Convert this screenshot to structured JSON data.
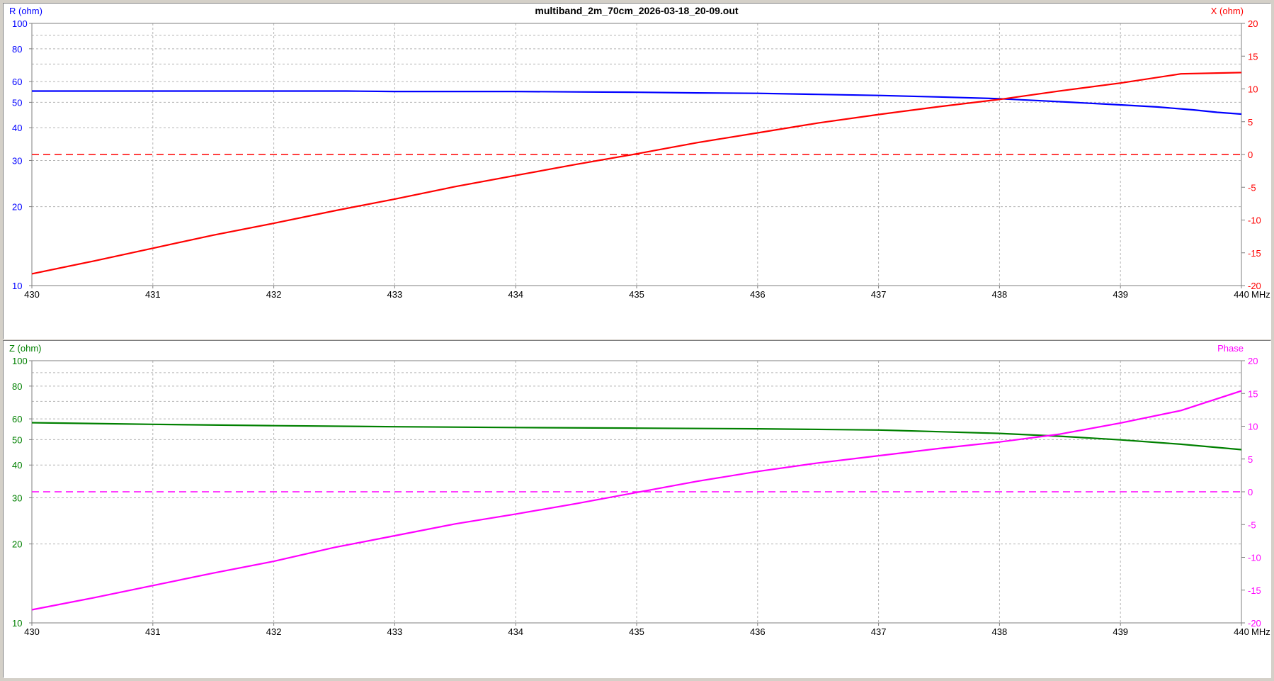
{
  "window": {
    "title": "multiband_2m_70cm_2026-03-18_20-09.out"
  },
  "colors": {
    "r": "#0000ff",
    "x": "#ff0000",
    "z": "#008000",
    "phase": "#ff00ff",
    "grid": "#b4b4b4",
    "frame": "#7f7f7f"
  },
  "chart_data": [
    {
      "type": "line",
      "title": "multiband_2m_70cm_2026-03-18_20-09.out",
      "xlabel": "MHz",
      "xlim": [
        430,
        440
      ],
      "x_ticks": [
        "430",
        "431",
        "432",
        "433",
        "434",
        "435",
        "436",
        "437",
        "438",
        "439",
        "440"
      ],
      "left_axis": {
        "label": "R (ohm)",
        "scale": "log",
        "lim": [
          10,
          100
        ],
        "ticks": [
          "10",
          "20",
          "30",
          "40",
          "50",
          "60",
          "80",
          "100"
        ]
      },
      "right_axis": {
        "label": "X (ohm)",
        "scale": "linear",
        "lim": [
          -20,
          20
        ],
        "ticks": [
          "-20",
          "-15",
          "-10",
          "-5",
          "0",
          "5",
          "10",
          "15",
          "20"
        ]
      },
      "grid": true,
      "reference_line": {
        "axis": "right",
        "value": 0,
        "style": "dashed"
      },
      "series": [
        {
          "name": "R",
          "axis": "left",
          "x": [
            430,
            431,
            432,
            432.6,
            433,
            434,
            434.5,
            435,
            435.5,
            436,
            436.5,
            437,
            437.5,
            438,
            438.3,
            438.6,
            439,
            439.3,
            439.6,
            439.8,
            440
          ],
          "y": [
            55.2,
            55.2,
            55.2,
            55.2,
            55.0,
            55.0,
            54.8,
            54.6,
            54.3,
            54.1,
            53.6,
            53.1,
            52.4,
            51.6,
            50.8,
            50.0,
            48.9,
            48.0,
            46.8,
            45.8,
            45.1
          ]
        },
        {
          "name": "X",
          "axis": "right",
          "x": [
            430,
            430.5,
            431,
            431.5,
            432,
            432.5,
            433,
            433.5,
            434,
            434.5,
            435,
            435.5,
            436,
            436.5,
            437,
            437.5,
            438,
            438.5,
            439,
            439.5,
            440
          ],
          "y": [
            -18.2,
            -16.3,
            -14.3,
            -12.3,
            -10.5,
            -8.6,
            -6.8,
            -4.9,
            -3.2,
            -1.5,
            0.1,
            1.8,
            3.3,
            4.8,
            6.1,
            7.3,
            8.4,
            9.7,
            10.9,
            12.3,
            12.5
          ]
        }
      ]
    },
    {
      "type": "line",
      "xlabel": "MHz",
      "xlim": [
        430,
        440
      ],
      "x_ticks": [
        "430",
        "431",
        "432",
        "433",
        "434",
        "435",
        "436",
        "437",
        "438",
        "439",
        "440"
      ],
      "left_axis": {
        "label": "Z (ohm)",
        "scale": "log",
        "lim": [
          10,
          100
        ],
        "ticks": [
          "10",
          "20",
          "30",
          "40",
          "50",
          "60",
          "80",
          "100"
        ]
      },
      "right_axis": {
        "label": "Phase",
        "scale": "linear",
        "lim": [
          -20,
          20
        ],
        "ticks": [
          "-20",
          "-15",
          "-10",
          "-5",
          "0",
          "5",
          "10",
          "15",
          "20"
        ]
      },
      "grid": true,
      "reference_line": {
        "axis": "right",
        "value": 0,
        "style": "dashed"
      },
      "series": [
        {
          "name": "Z",
          "axis": "left",
          "x": [
            430,
            431,
            432,
            433,
            434,
            435,
            436,
            437,
            437.5,
            438,
            438.5,
            439,
            439.5,
            440
          ],
          "y": [
            58.0,
            57.2,
            56.5,
            56.0,
            55.6,
            55.3,
            55.0,
            54.4,
            53.6,
            52.8,
            51.5,
            49.9,
            48.0,
            45.8
          ]
        },
        {
          "name": "Phase",
          "axis": "right",
          "x": [
            430,
            430.5,
            431,
            431.5,
            432,
            432.5,
            433,
            433.5,
            434,
            434.5,
            435,
            435.5,
            436,
            436.5,
            437,
            437.5,
            438,
            438.5,
            439,
            439.5,
            440
          ],
          "y": [
            -18.0,
            -16.2,
            -14.3,
            -12.4,
            -10.6,
            -8.5,
            -6.7,
            -4.9,
            -3.4,
            -1.8,
            -0.1,
            1.6,
            3.1,
            4.4,
            5.5,
            6.6,
            7.6,
            8.8,
            10.5,
            12.4,
            15.4
          ]
        }
      ]
    }
  ]
}
